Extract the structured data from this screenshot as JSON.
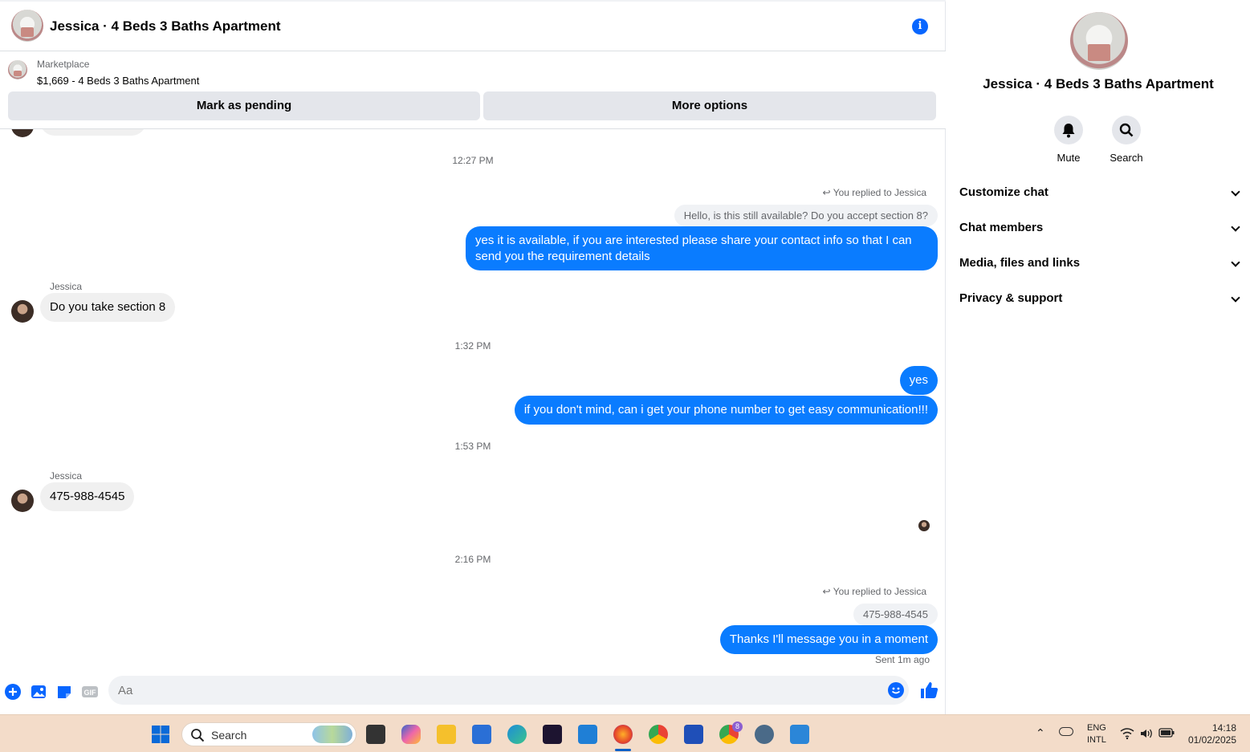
{
  "header": {
    "title": "Jessica · 4 Beds 3 Baths Apartment",
    "info_icon": "info-icon"
  },
  "marketplace": {
    "label": "Marketplace",
    "item": "$1,669 - 4 Beds 3 Baths Apartment",
    "mark_pending": "Mark as pending",
    "more_options": "More options"
  },
  "messages": {
    "ts1": "12:27 PM",
    "replied1": "You replied to Jessica",
    "quoted1": "Hello, is this still available? Do you accept section 8?",
    "out1_line1": "yes it is available, if you are interested please share your contact info so that I can",
    "out1_line2": "send you the requirement details",
    "sender1": "Jessica",
    "in1": "Do you take section 8",
    "ts2": "1:32 PM",
    "out2": "yes",
    "out3": "if you don't mind, can i get your phone number to get easy communication!!!",
    "ts3": "1:53 PM",
    "sender2": "Jessica",
    "in2": "475-988-4545",
    "ts4": "2:16 PM",
    "replied2": "You replied to Jessica",
    "quoted2": "475-988-4545",
    "out4": "Thanks I'll message you in a moment",
    "status": "Sent 1m ago"
  },
  "composer": {
    "placeholder": "Aa",
    "value": ""
  },
  "sidebar": {
    "title": "Jessica · 4 Beds 3 Baths Apartment",
    "mute": "Mute",
    "search": "Search",
    "sections": [
      "Customize chat",
      "Chat members",
      "Media, files and links",
      "Privacy & support"
    ]
  },
  "taskbar": {
    "search": "Search",
    "lang1": "ENG",
    "lang2": "INTL",
    "time": "14:18",
    "date": "01/02/2025",
    "badge": "8"
  },
  "colors": {
    "accent": "#0866ff",
    "outgoing": "#0a7cff",
    "incoming": "#f0f0f0",
    "taskbar": "#f3dcc9"
  }
}
